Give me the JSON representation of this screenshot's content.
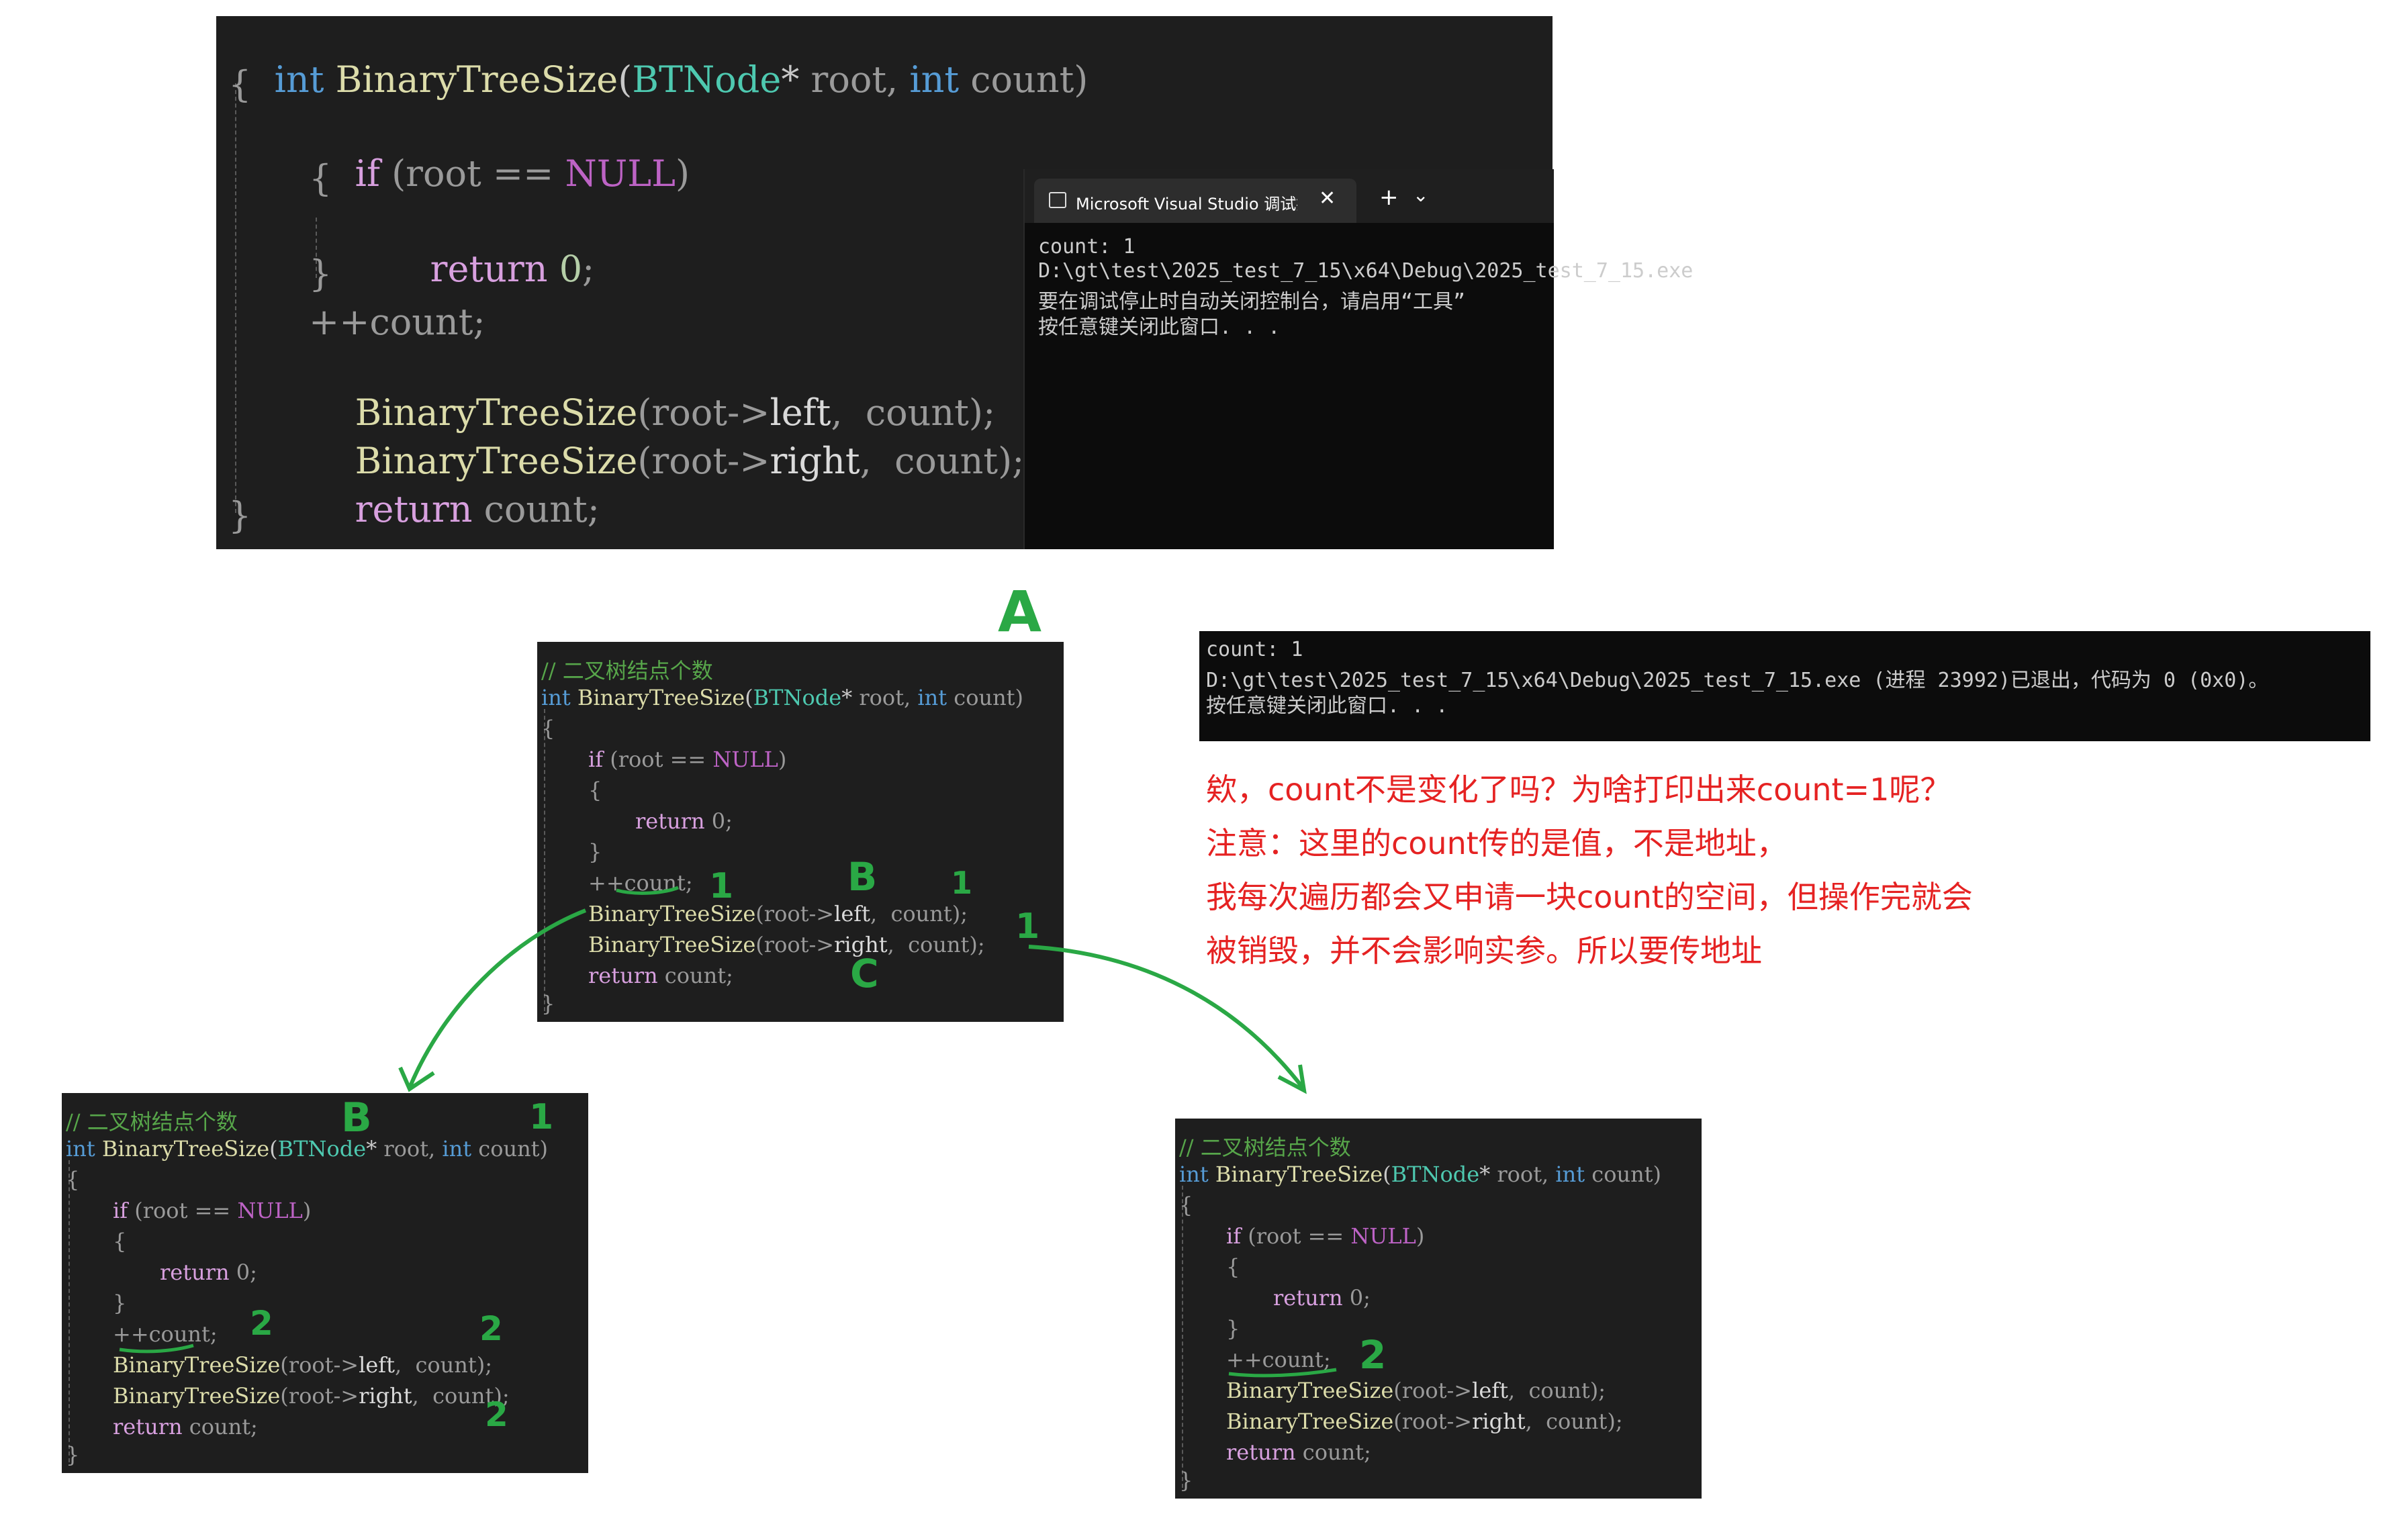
{
  "top_code": {
    "line1": [
      "int",
      " ",
      "BinaryTreeSize",
      "(",
      "BTNode",
      "*",
      " root, ",
      "int",
      " count)"
    ],
    "line2": "{",
    "line3": [
      "if",
      " (root == ",
      "NULL",
      ")"
    ],
    "line4": "{",
    "line5": [
      "return",
      " ",
      "0",
      ";"
    ],
    "line6": "}",
    "line7": "++count;",
    "line8": [
      "BinaryTreeSize",
      "(root->",
      "left",
      ",  count);"
    ],
    "line9": [
      "BinaryTreeSize",
      "(root->",
      "right",
      ",  count);"
    ],
    "line10": [
      "return",
      " count;"
    ],
    "line11": "}"
  },
  "terminal": {
    "tab_title": "Microsoft Visual Studio 调试控制台",
    "close_glyph": "✕",
    "new_tab_glyph": "+",
    "dropdown_glyph": "⌄",
    "lines": [
      "count: 1",
      "D:\\gt\\test\\2025_test_7_15\\x64\\Debug\\2025_test_7_15.exe",
      "要在调试停止时自动关闭控制台，请启用“工具”",
      "按任意键关闭此窗口. . ."
    ]
  },
  "terminal2": {
    "lines": [
      "count: 1",
      "D:\\gt\\test\\2025_test_7_15\\x64\\Debug\\2025_test_7_15.exe (进程 23992)已退出，代码为 0 (0x0)。",
      "按任意键关闭此窗口. . ."
    ]
  },
  "small_code": {
    "comment": "// 二叉树结点个数",
    "sig": [
      "int",
      " BinaryTreeSize",
      "(",
      "BTNode",
      "*",
      " root, ",
      "int",
      " count)"
    ],
    "open": "{",
    "if_line": [
      "if",
      " (root == ",
      "NULL",
      ")"
    ],
    "inner_open": "{",
    "ret0": [
      "return",
      " 0;"
    ],
    "inner_close": "}",
    "inc": "++count;",
    "call_left": [
      "BinaryTreeSize",
      "(root->",
      "left",
      ",  count);"
    ],
    "call_right": [
      "BinaryTreeSize",
      "(root->",
      "right",
      ",  count);"
    ],
    "ret_count": [
      "return",
      " count;"
    ],
    "close": "}"
  },
  "notes": [
    "欸，count不是变化了吗？为啥打印出来count=1呢？",
    "注意：这里的count传的是值，不是地址，",
    "我每次遍历都会又申请一块count的空间，但操作完就会",
    "被销毁，并不会影响实参。所以要传地址"
  ],
  "handwriting": {
    "A": "A",
    "B": "B",
    "C": "C",
    "one": "1",
    "two": "2"
  },
  "colors": {
    "annotation_red": "#e52222",
    "handwriting_green": "#2aa845",
    "editor_bg": "#1e1e1e",
    "terminal_bg": "#0c0c0c"
  }
}
